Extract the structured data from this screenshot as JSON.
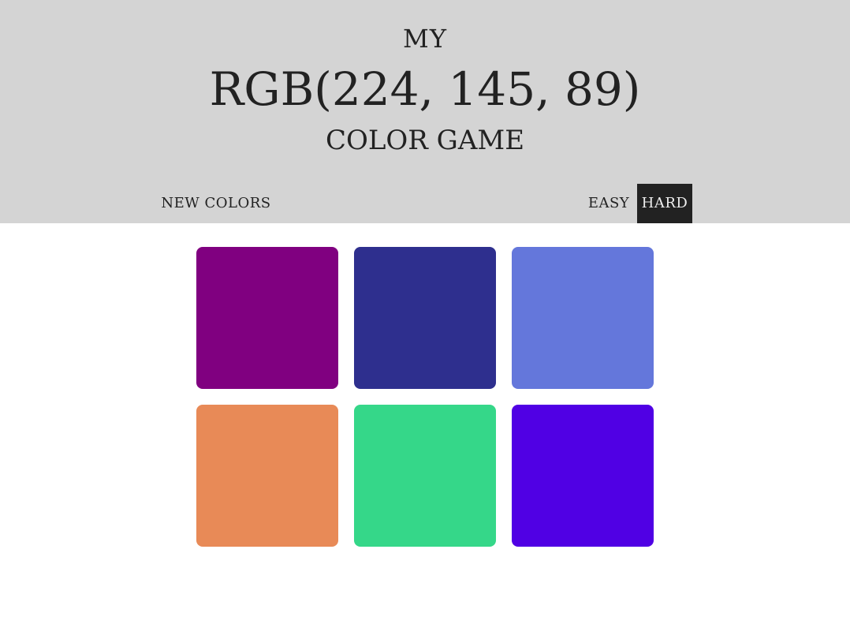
{
  "header": {
    "line1": "MY",
    "rgb": "RGB(224, 145, 89)",
    "line3": "COLOR GAME",
    "background": "#d4d4d4"
  },
  "controls": {
    "new_colors": "NEW COLORS",
    "easy": "EASY",
    "hard": "HARD",
    "active_mode": "hard"
  },
  "squares": [
    {
      "color": "#800080"
    },
    {
      "color": "#2e2f8e"
    },
    {
      "color": "#6477db"
    },
    {
      "color": "#e88a57"
    },
    {
      "color": "#35d789"
    },
    {
      "color": "#5000e4"
    }
  ]
}
